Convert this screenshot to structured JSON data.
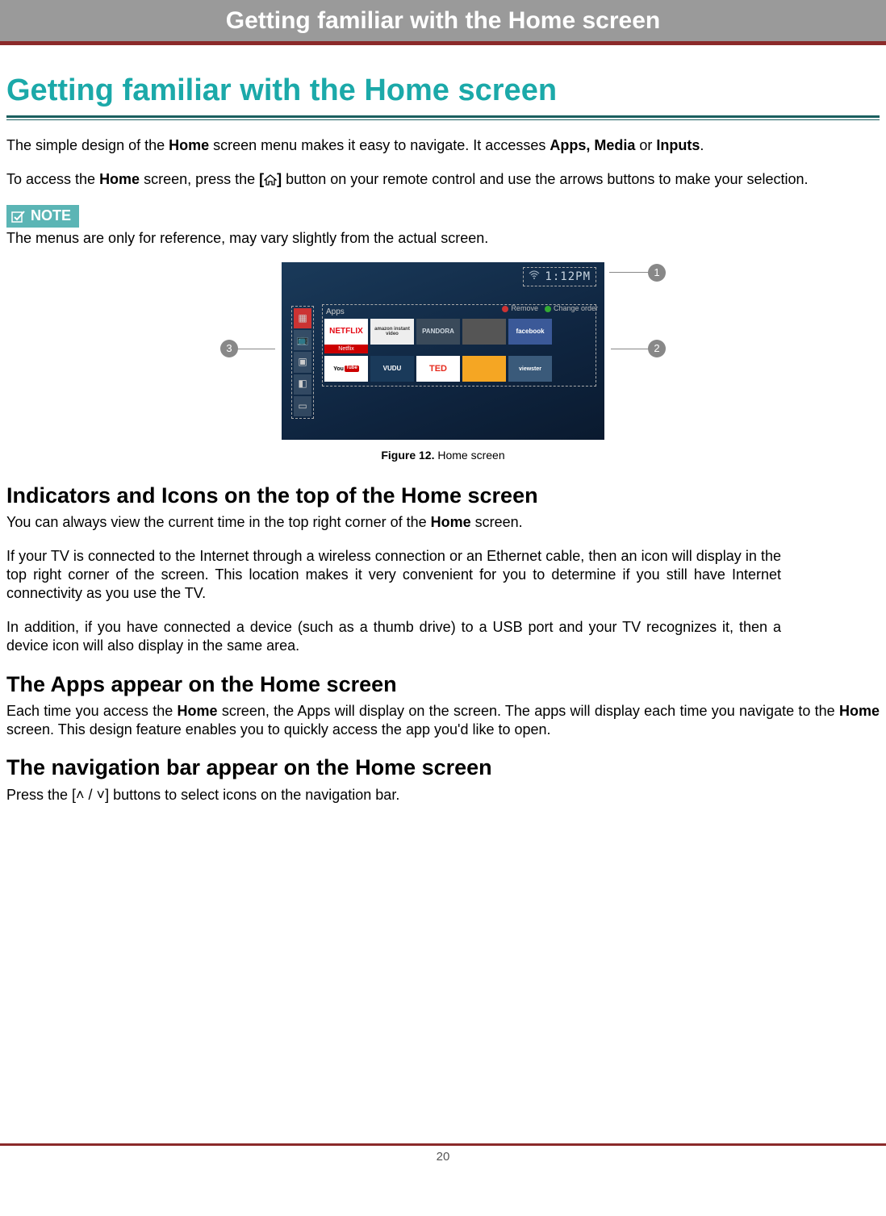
{
  "header": {
    "title": "Getting familiar with the Home screen"
  },
  "main_title": "Getting familiar with the Home screen",
  "intro": {
    "p1_pre": "The simple design of the ",
    "p1_b1": "Home",
    "p1_mid": " screen menu makes it easy to navigate. It accesses ",
    "p1_b2": "Apps, Media",
    "p1_mid2": " or ",
    "p1_b3": "Inputs",
    "p1_end": ".",
    "p2_pre": "To access the ",
    "p2_b1": "Home",
    "p2_mid": " screen, press the ",
    "p2_bracket_open": "[",
    "p2_bracket_close": "]",
    "p2_end": " button on your remote control and use the arrows buttons to make your selection."
  },
  "note": {
    "badge": "NOTE",
    "text": "The menus are only for reference, may vary slightly from the actual screen."
  },
  "figure": {
    "clock": "1:12PM",
    "apps_label": "Apps",
    "action_remove": "Remove",
    "action_change": "Change order",
    "tiles_row1": {
      "netflix": "NETFLIX",
      "amazon": "amazon instant video",
      "pandora": "PANDORA",
      "facebook": "facebook"
    },
    "tiles_row2": {
      "youtube_pre": "You",
      "youtube_tube": "Tube",
      "vudu": "VUDU",
      "ted": "TED",
      "viewster": "viewster"
    },
    "netflix_sub": "Netflix",
    "callouts": {
      "c1": "1",
      "c2": "2",
      "c3": "3"
    },
    "caption_strong": "Figure 12.",
    "caption_rest": " Home screen"
  },
  "sections": {
    "indicators": {
      "title": "Indicators and Icons on the top of the Home screen",
      "p1_pre": "You can always view the current time in the top right corner of the ",
      "p1_b": "Home",
      "p1_end": " screen.",
      "p2": "If your TV is connected to the Internet through a wireless connection or an Ethernet cable, then an icon will display in the top right corner of the screen. This location makes it very convenient for you to determine if you still have Internet connectivity as you use the TV.",
      "p3": "In addition, if you have connected a device (such as a thumb drive) to a USB port and your TV recognizes it, then a device icon will also display in the same area."
    },
    "apps": {
      "title": "The Apps appear on the Home screen",
      "p1_pre": "Each time you access the ",
      "p1_b1": "Home",
      "p1_mid": " screen, the Apps will display on the screen. The apps will display each time you navigate to the ",
      "p1_b2": "Home",
      "p1_end": " screen. This design feature enables you to quickly access the app you'd like to open."
    },
    "nav": {
      "title": "The navigation bar appear on the Home screen",
      "p1_pre": "Press the [",
      "p1_arrows": "˄ / ˅",
      "p1_mid": "] buttons to select icons on the navigation bar."
    }
  },
  "page_number": "20"
}
